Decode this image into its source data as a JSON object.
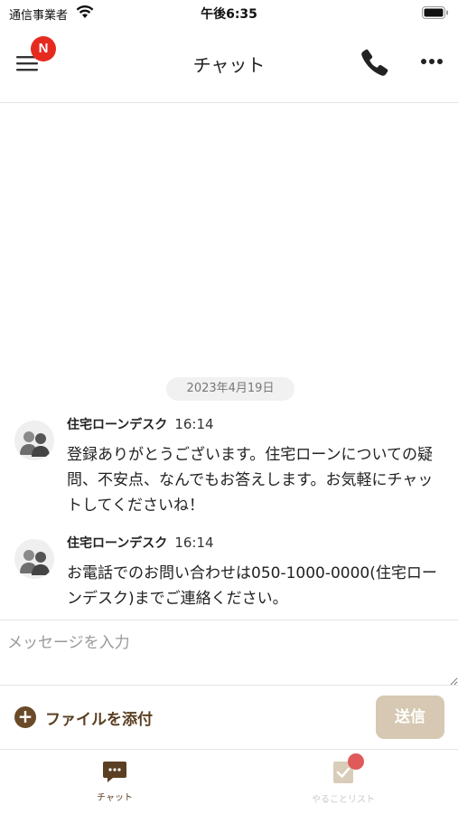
{
  "status_bar": {
    "carrier": "通信事業者",
    "time": "午後6:35"
  },
  "header": {
    "title": "チャット",
    "menu_badge": "N"
  },
  "chat": {
    "date": "2023年4月19日",
    "messages": [
      {
        "sender": "住宅ローンデスク",
        "time": "16:14",
        "text": "登録ありがとうございます。住宅ローンについての疑問、不安点、なんでもお答えします。お気軽にチャットしてくださいね！"
      },
      {
        "sender": "住宅ローンデスク",
        "time": "16:14",
        "text": "お電話でのお問い合わせは050-1000-0000(住宅ローンデスク)までご連絡ください。"
      }
    ]
  },
  "composer": {
    "placeholder": "メッセージを入力",
    "attach_label": "ファイルを添付",
    "send_label": "送信"
  },
  "tabs": [
    {
      "label": "チャット",
      "icon": "chat-bubble-icon",
      "active": true
    },
    {
      "label": "やることリスト",
      "icon": "checklist-icon",
      "active": false
    }
  ],
  "colors": {
    "brand_brown": "#5a3f22",
    "send_disabled": "#d6c8b2",
    "badge_red": "#e52b20"
  }
}
